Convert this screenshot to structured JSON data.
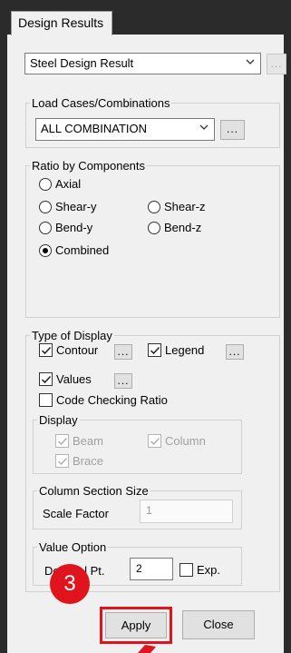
{
  "tab": {
    "title": "Design Results"
  },
  "result_type": {
    "selected": "Steel Design Result",
    "more_label": "..."
  },
  "load_cases": {
    "legend": "Load Cases/Combinations",
    "selected": "ALL COMBINATION",
    "more_label": "..."
  },
  "ratio": {
    "legend": "Ratio by Components",
    "options": [
      "Axial",
      "Shear-y",
      "Shear-z",
      "Bend-y",
      "Bend-z",
      "Combined"
    ],
    "selected": "Combined"
  },
  "display_type": {
    "legend": "Type of Display",
    "contour": {
      "label": "Contour",
      "checked": true,
      "more_label": "..."
    },
    "legend_opt": {
      "label": "Legend",
      "checked": true,
      "more_label": "..."
    },
    "values": {
      "label": "Values",
      "checked": true,
      "more_label": "..."
    },
    "code_ratio": {
      "label": "Code Checking Ratio",
      "checked": false
    },
    "display": {
      "legend": "Display",
      "beam": "Beam",
      "column": "Column",
      "brace": "Brace"
    },
    "column_section": {
      "legend": "Column Section Size",
      "scale_label": "Scale Factor",
      "scale_value": "1"
    },
    "value_option": {
      "legend": "Value Option",
      "decimal_label": "Decimal Pt.",
      "decimal_value": "2",
      "exp_label": "Exp."
    }
  },
  "buttons": {
    "apply": "Apply",
    "close": "Close"
  },
  "annotation": {
    "step": "3",
    "color": "#e0141c"
  }
}
